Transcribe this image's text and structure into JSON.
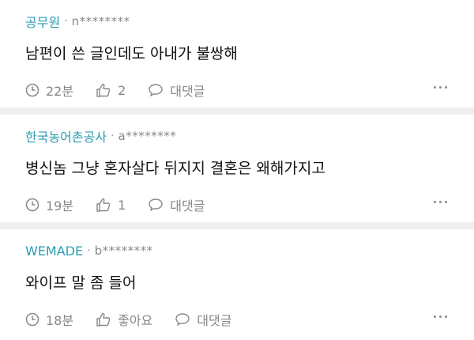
{
  "comments": [
    {
      "company": "공무원",
      "user": "n********",
      "text": "남편이 쓴 글인데도 아내가 불쌍해",
      "time": "22분",
      "likes": "2",
      "reply_label": "대댓글"
    },
    {
      "company": "한국농어촌공사",
      "user": "a********",
      "text": "병신놈 그냥 혼자살다 뒤지지 결혼은 왜해가지고",
      "time": "19분",
      "likes": "1",
      "reply_label": "대댓글"
    },
    {
      "company": "WEMADE",
      "user": "b********",
      "text": "와이프 말 좀 들어",
      "time": "18분",
      "likes": "좋아요",
      "reply_label": "대댓글"
    }
  ],
  "separator": "·",
  "icons": {
    "time": "clock-icon",
    "like": "thumbs-up-icon",
    "reply": "speech-bubble-icon",
    "more": "more-dots-icon"
  },
  "colors": {
    "company": "#2b9bb2",
    "meta": "#888888",
    "divider": "#efefef"
  }
}
